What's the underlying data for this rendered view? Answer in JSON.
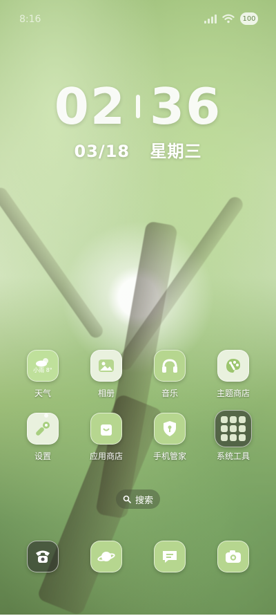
{
  "status_bar": {
    "time": "8:16",
    "battery_label": "100",
    "icons": [
      "signal-icon",
      "wifi-icon",
      "battery-icon"
    ]
  },
  "lock_clock": {
    "hours": "02",
    "minutes": "36",
    "date": "03/18",
    "weekday": "星期三"
  },
  "weather_widget": {
    "text": "小雨 8°"
  },
  "apps": [
    {
      "label": "天气",
      "icon": "weather-icon"
    },
    {
      "label": "相册",
      "icon": "gallery-icon"
    },
    {
      "label": "音乐",
      "icon": "headphones-icon"
    },
    {
      "label": "主题商店",
      "icon": "palette-icon"
    },
    {
      "label": "设置",
      "icon": "wrench-icon"
    },
    {
      "label": "应用商店",
      "icon": "shopping-bag-icon"
    },
    {
      "label": "手机管家",
      "icon": "shield-icon"
    },
    {
      "label": "系统工具",
      "icon": "folder-icon"
    }
  ],
  "search": {
    "label": "搜索"
  },
  "dock": [
    {
      "icon": "phone-icon"
    },
    {
      "icon": "planet-icon"
    },
    {
      "icon": "message-icon"
    },
    {
      "icon": "camera-icon"
    }
  ],
  "colors": {
    "icon_bg": "#e9f1de",
    "accent_green": "#6a8a4f"
  }
}
